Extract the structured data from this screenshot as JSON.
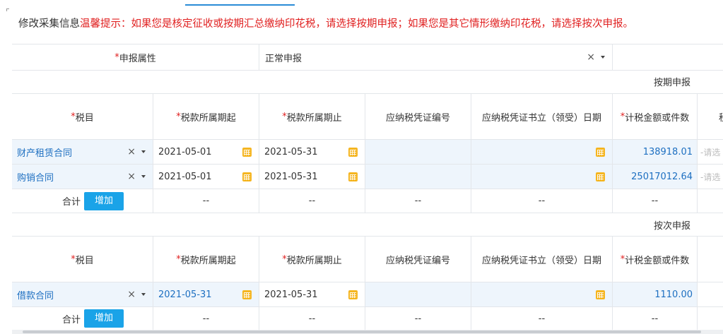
{
  "title": {
    "prefix": "修改采集信息",
    "tip": "温馨提示：如果您是核定征收或按期汇总缴纳印花税，请选择按期申报；如果您是其它情形缴纳印花税，请选择按次申报。"
  },
  "attribute": {
    "label": "申报属性",
    "value": "正常申报",
    "clear": "×"
  },
  "required_mark": "*",
  "columns": {
    "tax_item": "税目",
    "period_start": "税款所属期起",
    "period_end": "税款所属期止",
    "voucher_no": "应纳税凭证编号",
    "voucher_date": "应纳税凭证书立（领受）日期",
    "amount": "计税金额或件数",
    "next_cut": "税"
  },
  "periodic": {
    "section_label": "按期申报",
    "rows": [
      {
        "tax_item": "财产租赁合同",
        "start": "2021-05-01",
        "end": "2021-05-31",
        "amount": "138918.01",
        "next": "-请选"
      },
      {
        "tax_item": "购销合同",
        "start": "2021-05-01",
        "end": "2021-05-31",
        "amount": "25017012.64",
        "next": "-请选"
      }
    ],
    "total_label": "合计",
    "add_label": "增加",
    "dash": "--"
  },
  "per_time": {
    "section_label": "按次申报",
    "rows": [
      {
        "tax_item": "借款合同",
        "start": "2021-05-31",
        "end": "2021-05-31",
        "amount": "1110.00"
      }
    ],
    "total_label": "合计",
    "add_label": "增加",
    "dash": "--"
  },
  "icons": {
    "clear": "×"
  },
  "colors": {
    "accent": "#1aa3e8",
    "warning": "#e02020",
    "link": "#1d6fc1",
    "calendar": "#f5b520"
  }
}
